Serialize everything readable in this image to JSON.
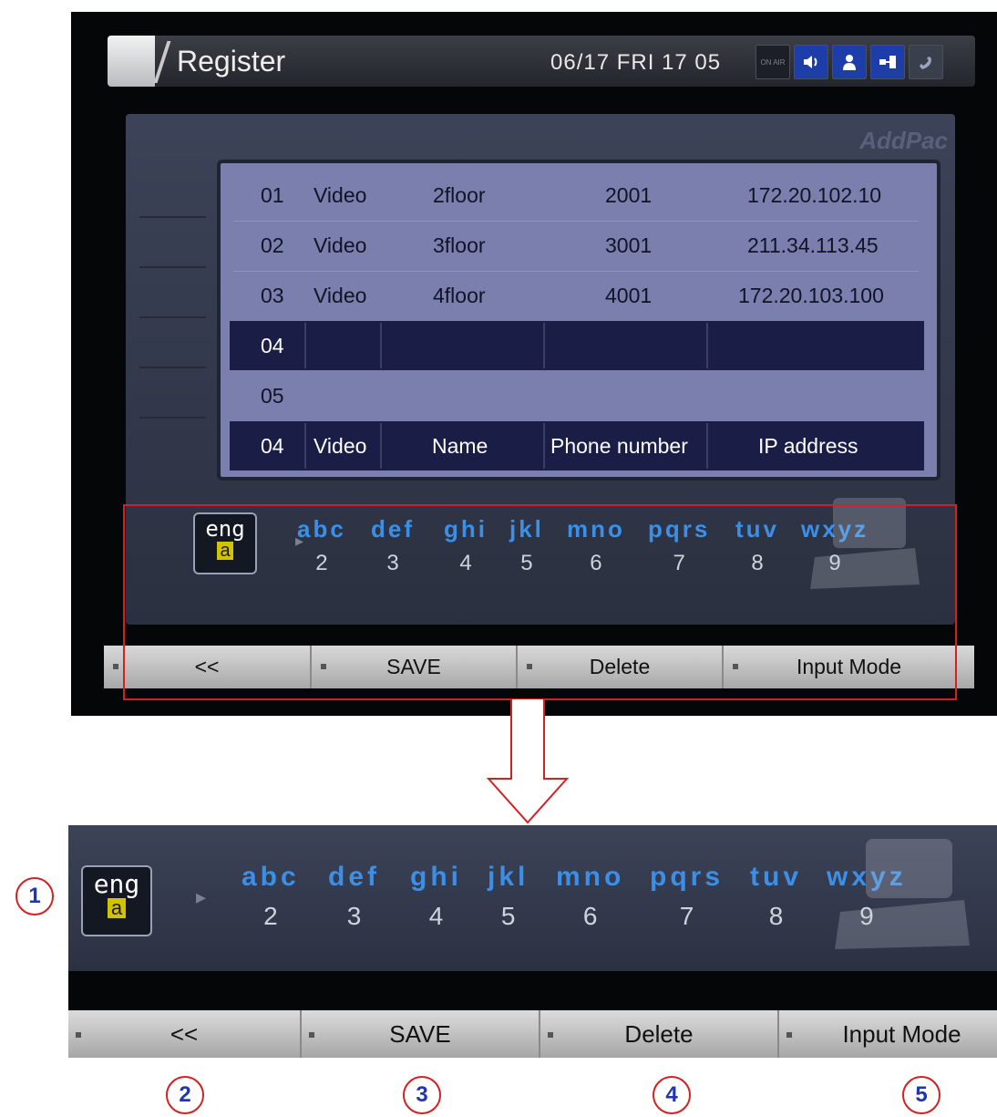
{
  "header": {
    "title": "Register",
    "datetime": "06/17 FRI 17 05",
    "status_icons": [
      "on-air-icon",
      "speaker-icon",
      "person-icon",
      "network-icon",
      "phone-icon"
    ],
    "onair_text": "ON AIR"
  },
  "brand": "AddPac",
  "table": {
    "rows": [
      {
        "no": "01",
        "type": "Video",
        "name": "2floor",
        "phone": "2001",
        "ip": "172.20.102.10"
      },
      {
        "no": "02",
        "type": "Video",
        "name": "3floor",
        "phone": "3001",
        "ip": "211.34.113.45"
      },
      {
        "no": "03",
        "type": "Video",
        "name": "4floor",
        "phone": "4001",
        "ip": "172.20.103.100"
      },
      {
        "no": "04",
        "type": "",
        "name": "",
        "phone": "",
        "ip": ""
      },
      {
        "no": "05",
        "type": "",
        "name": "",
        "phone": "",
        "ip": ""
      }
    ],
    "edit_row": {
      "no": "04",
      "type": "Video",
      "name": "Name",
      "phone": "Phone number",
      "ip": "IP address"
    },
    "selected_index": 3
  },
  "input_mode": {
    "lang": "eng",
    "case": "a"
  },
  "keypad": [
    {
      "letters": "abc",
      "digit": "2"
    },
    {
      "letters": "def",
      "digit": "3"
    },
    {
      "letters": "ghi",
      "digit": "4"
    },
    {
      "letters": "jkl",
      "digit": "5"
    },
    {
      "letters": "mno",
      "digit": "6"
    },
    {
      "letters": "pqrs",
      "digit": "7"
    },
    {
      "letters": "tuv",
      "digit": "8"
    },
    {
      "letters": "wxyz",
      "digit": "9"
    }
  ],
  "function_keys": [
    "<<",
    "SAVE",
    "Delete",
    "Input Mode"
  ],
  "callouts": [
    "1",
    "2",
    "3",
    "4",
    "5"
  ],
  "colors": {
    "highlight_red": "#d42020",
    "callout_number": "#1f35b5",
    "keypad_letters": "#3b8fe6",
    "selected_row": "#1a1e47"
  }
}
